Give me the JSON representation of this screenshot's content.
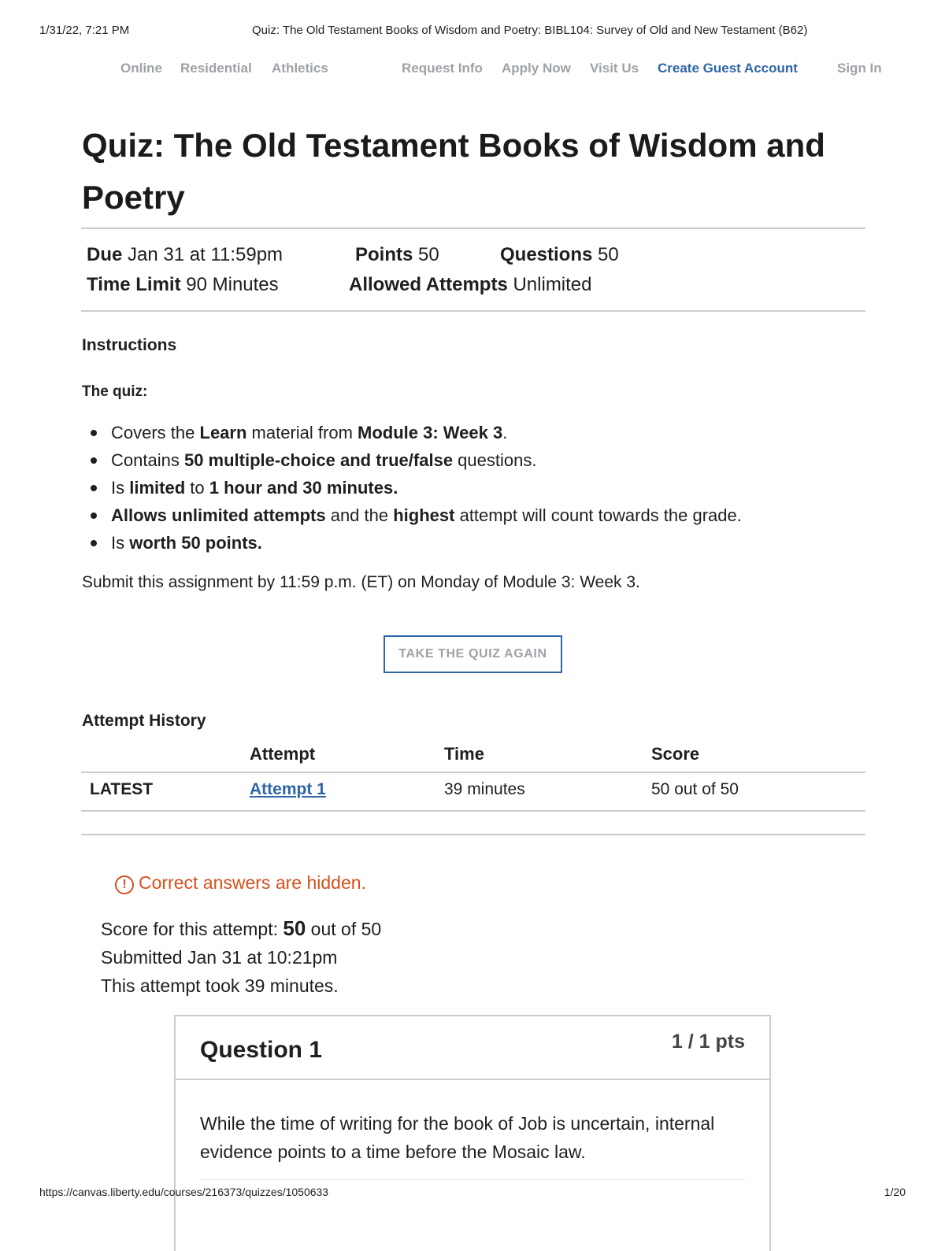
{
  "print_header": {
    "datetime": "1/31/22, 7:21 PM",
    "page_title": "Quiz: The Old Testament Books of Wisdom and Poetry: BIBL104: Survey of Old and New Testament (B62)"
  },
  "nav": {
    "online": "Online",
    "residential": "Residential",
    "athletics": "Athletics",
    "request_info": "Request Info",
    "apply_now": "Apply Now",
    "visit_us": "Visit Us",
    "create_guest_account": "Create Guest Account",
    "sign_in": "Sign In",
    "accent_color": "#2e66a8"
  },
  "quiz": {
    "title": "Quiz: The Old Testament Books of Wisdom and Poetry",
    "due_label": "Due",
    "due_value": "Jan 31 at 11:59pm",
    "points_label": "Points",
    "points_value": "50",
    "questions_label": "Questions",
    "questions_value": "50",
    "time_limit_label": "Time Limit",
    "time_limit_value": "90 Minutes",
    "attempts_label": "Allowed Attempts",
    "attempts_value": "Unlimited"
  },
  "instructions": {
    "heading": "Instructions",
    "intro": "The quiz:",
    "b1": {
      "t1": "Covers the ",
      "s1": "Learn",
      "t2": " material from ",
      "s2": "Module 3: Week 3",
      "t3": "."
    },
    "b2": {
      "t1": "Contains ",
      "s1": "50 multiple-choice and true/false",
      "t2": " questions."
    },
    "b3": {
      "t1": "Is ",
      "s1": "limited",
      "t2": " to ",
      "s2": "1 hour and 30 minutes."
    },
    "b4": {
      "s1": "Allows unlimited attempts",
      "t1": " and the ",
      "s2": "highest",
      "t2": " attempt will count towards the grade."
    },
    "b5": {
      "t1": "Is ",
      "s1": "worth 50 points."
    },
    "submit_note": "Submit this assignment by 11:59 p.m. (ET) on Monday of Module 3: Week 3."
  },
  "take_quiz_button": "TAKE THE QUIZ AGAIN",
  "attempt_history": {
    "heading": "Attempt History",
    "columns": [
      "Attempt",
      "Time",
      "Score"
    ],
    "rows": [
      {
        "tag": "LATEST",
        "attempt": "Attempt 1",
        "time": "39 minutes",
        "score": "50 out of 50"
      }
    ]
  },
  "attempt_details": {
    "warning_icon": "!",
    "warning": "Correct answers are hidden.",
    "score_prefix": "Score for this attempt: ",
    "score_value": "50",
    "score_suffix": " out of 50",
    "submitted": "Submitted Jan 31 at 10:21pm",
    "duration": "This attempt took 39 minutes."
  },
  "question": {
    "title": "Question 1",
    "points": "1 / 1 pts",
    "text": "While the time of writing for the book of Job is uncertain, internal evidence points to a time before the Mosaic law."
  },
  "print_footer": {
    "url": "https://canvas.liberty.edu/courses/216373/quizzes/1050633",
    "page": "1/20"
  }
}
